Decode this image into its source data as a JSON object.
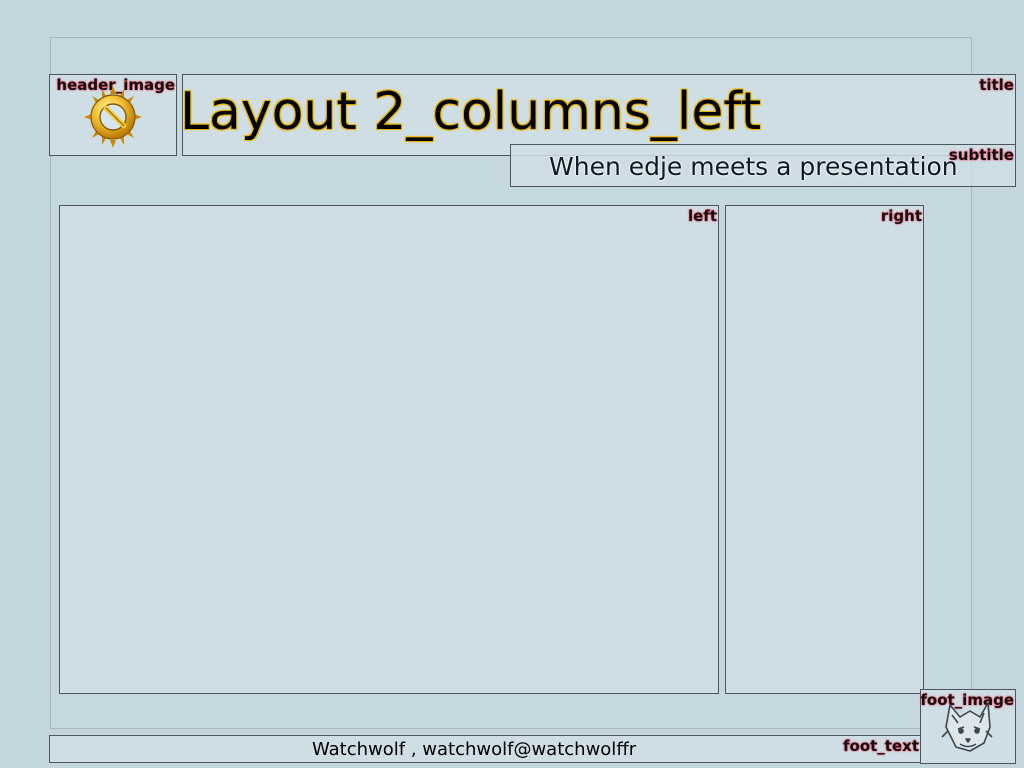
{
  "layout_name": "Layout 2_columns_left",
  "subtitle": "When edje meets a presentation",
  "footer": "Watchwolf , watchwolf@watchwolffr",
  "regions": {
    "header_image": "header_image",
    "title": "title",
    "subtitle": "subtitle",
    "left": "left",
    "right": "right",
    "foot_image": "foot_image",
    "foot_text": "foot_text"
  },
  "icons": {
    "header": "enlightenment-e-logo-icon",
    "footer": "watchwolf-wolf-mascot-icon"
  },
  "colors": {
    "background": "#c3d6de",
    "panel": "#cfdee5",
    "title_glow": "#e8b400",
    "label_glow": "#ff3b5a"
  }
}
